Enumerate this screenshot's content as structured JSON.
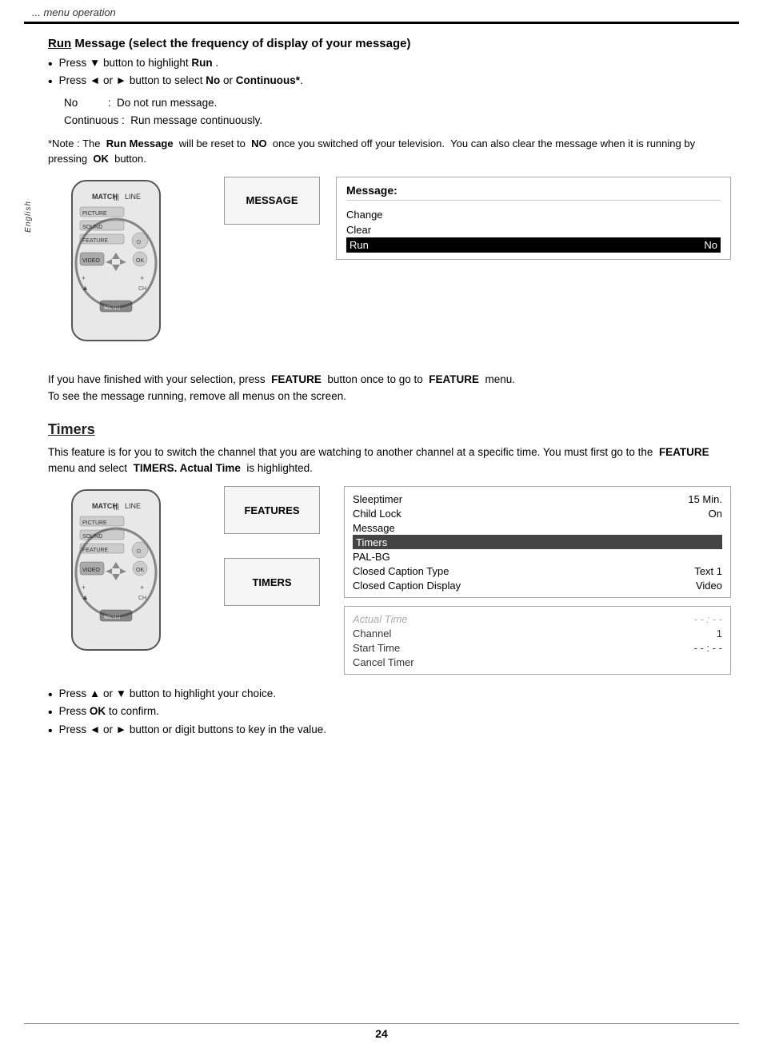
{
  "header": {
    "text": "... menu operation"
  },
  "run_message_section": {
    "title": "Run Message (select the frequency of display of your message)",
    "title_underline": "Run",
    "bullets": [
      {
        "text_parts": [
          "Press ",
          "▼",
          " button to highlight ",
          "Run",
          "."
        ]
      },
      {
        "text_parts": [
          "Press ",
          "◄",
          " or ",
          "►",
          " button to select ",
          "No",
          " or ",
          "Continuous*",
          "."
        ]
      }
    ],
    "indent": [
      {
        "label": "No",
        "separator": ":",
        "value": "Do not run message."
      },
      {
        "label": "Continuous",
        "separator": ":",
        "value": "Run message continuously."
      }
    ],
    "note": "*Note : The  Run Message  will be reset to  NO  once you switched off your television.  You can also clear the message when it is running by pressing  OK  button.",
    "menu_label": "MESSAGE",
    "panel_title": "Message:",
    "panel_items": [
      {
        "label": "Change",
        "value": ""
      },
      {
        "label": "Clear",
        "value": ""
      },
      {
        "label": "Run",
        "value": "No",
        "highlighted": true
      }
    ]
  },
  "finish_note": "If you have finished with your selection, press  FEATURE  button once to go to  FEATURE  menu. To see the message running, remove all menus on the screen.",
  "timers_section": {
    "title": "Timers",
    "description": "This feature is for you to switch the channel that you are watching to another channel at a specific time. You must first go to the  FEATURE  menu and select  TIMERS. Actual Time  is highlighted.",
    "features_menu_label": "FEATURES",
    "timers_menu_label": "TIMERS",
    "features_panel_title": "",
    "features_panel_items": [
      {
        "label": "Sleeptimer",
        "value": "15 Min."
      },
      {
        "label": "Child Lock",
        "value": "On"
      },
      {
        "label": "Message",
        "value": ""
      },
      {
        "label": "Timers",
        "value": "",
        "highlighted": true
      },
      {
        "label": "PAL-BG",
        "value": ""
      },
      {
        "label": "Closed Caption Type",
        "value": "Text 1"
      },
      {
        "label": "Closed Caption Display",
        "value": "Video"
      }
    ],
    "timers_panel_items": [
      {
        "label": "Actual Time",
        "value": "- - : - -",
        "faded": true
      },
      {
        "label": "Channel",
        "value": "1",
        "faded": false
      },
      {
        "label": "Start Time",
        "value": "- - : - -",
        "faded": false
      },
      {
        "label": "Cancel Timer",
        "value": "",
        "faded": false
      }
    ],
    "bullets": [
      {
        "text_parts": [
          "Press ",
          "▲",
          " or ",
          "▼",
          " button to highlight your choice."
        ]
      },
      {
        "text_parts": [
          "Press ",
          "OK",
          " to confirm."
        ]
      },
      {
        "text_parts": [
          "Press ",
          "◄",
          " or ",
          "►",
          " button or digit buttons to key in the value."
        ]
      }
    ]
  },
  "page_number": "24"
}
